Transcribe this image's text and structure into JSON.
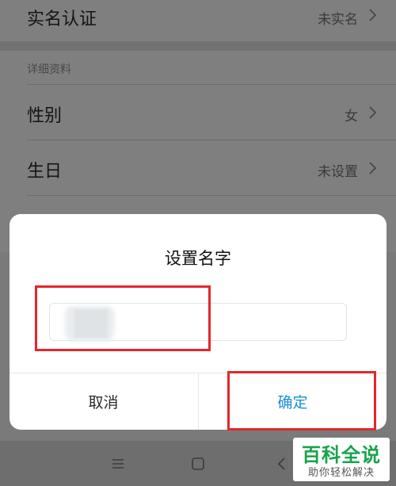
{
  "settings": {
    "realname": {
      "label": "实名认证",
      "value": "未实名"
    },
    "section_header": "详细资料",
    "gender": {
      "label": "性别",
      "value": "女"
    },
    "birthday": {
      "label": "生日",
      "value": "未设置"
    }
  },
  "dialog": {
    "title": "设置名字",
    "input_value": "",
    "input_placeholder": "",
    "cancel_label": "取消",
    "confirm_label": "确定"
  },
  "colors": {
    "confirm_text": "#1a8fd6",
    "highlight_border": "#e5262b",
    "watermark_green": "#17a34a"
  },
  "navbar": {
    "icons": [
      "menu-icon",
      "home-icon",
      "back-icon"
    ]
  },
  "watermark": {
    "main": "百科全说",
    "sub": "助你轻松解决"
  }
}
